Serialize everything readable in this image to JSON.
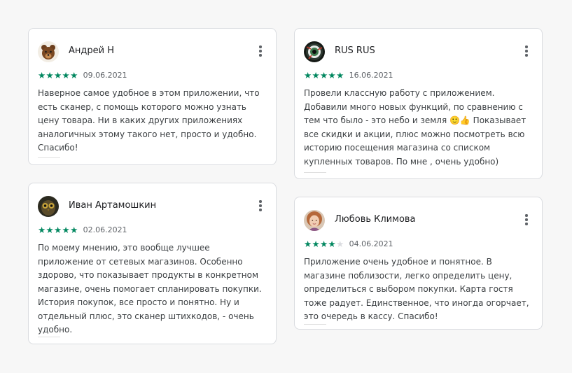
{
  "reviews": [
    {
      "author": "Андрей Н",
      "avatar": "bear-avatar-icon",
      "rating": 5,
      "date": "09.06.2021",
      "text": "Наверное самое удобное в этом приложении, что есть сканер, с помощь которого можно узнать цену товара. Ни в каких других приложениях аналогичных этому такого нет, просто и удобно. Спасибо!"
    },
    {
      "author": "Иван Артамошкин",
      "avatar": "owl-avatar-icon",
      "rating": 5,
      "date": "02.06.2021",
      "text": "По моему мнению, это вообще лучшее приложение от сетевых магазинов. Особенно здорово, что показывает продукты в конкретном магазине, очень помогает спланировать покупки. История покупок, все просто и понятно. Ну и отдельный плюс, это сканер штихкодов, - очень удобно."
    },
    {
      "author": "RUS RUS",
      "avatar": "eye-avatar-icon",
      "rating": 5,
      "date": "16.06.2021",
      "text": "Провели классную работу с приложением. Добавили много новых функций, по сравнению с тем что было - это небо и земля 🙂👍 Показывает все скидки и акции, плюс можно посмотреть всю историю посещения магазина со списком купленных товаров. По мне , очень удобно)"
    },
    {
      "author": "Любовь Климова",
      "avatar": "woman-avatar-icon",
      "rating": 4,
      "date": "04.06.2021",
      "text": "Приложение очень удобное и понятное. В магазине поблизости, легко определить цену, определиться с выбором покупки. Карта гостя тоже радует. Единственное, что иногда огорчает, это очередь в кассу. Спасибо!"
    }
  ],
  "colors": {
    "star_filled": "#01875f",
    "star_empty": "#dadce0",
    "card_border": "#dadce0",
    "background": "#f7f7f7"
  }
}
